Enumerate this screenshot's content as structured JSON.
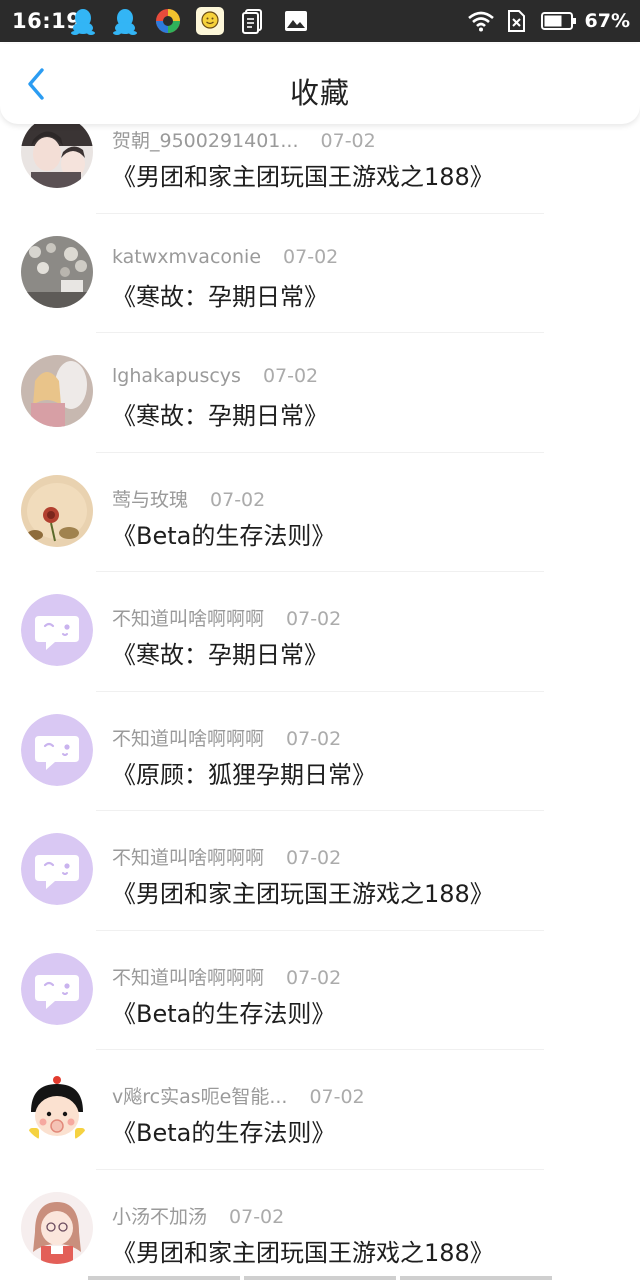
{
  "status_bar": {
    "time": "16:19",
    "battery_percent": "67%",
    "notification_icons": [
      "qq-icon",
      "qq-icon",
      "colorful-app-icon",
      "smiley-app-icon",
      "document-icon",
      "image-icon"
    ]
  },
  "header": {
    "title": "收藏",
    "back_icon": "chevron-left-icon"
  },
  "colors": {
    "accent": "#2b9cf2",
    "status_bar": "#2b2b2b",
    "placeholder_avatar": "#d9c8f3"
  },
  "items": [
    {
      "username": "贺朝_9500291401...",
      "date": "07-02",
      "title": "《男团和家主团玩国王游戏之188》",
      "avatar": "photo-boys"
    },
    {
      "username": "katwxmvaconie",
      "date": "07-02",
      "title": "《寒故：孕期日常》",
      "avatar": "photo-flowers"
    },
    {
      "username": "lghakapuscys",
      "date": "07-02",
      "title": "《寒故：孕期日常》",
      "avatar": "photo-girl-horse"
    },
    {
      "username": "莺与玫瑰",
      "date": "07-02",
      "title": "《Beta的生存法则》",
      "avatar": "photo-rose"
    },
    {
      "username": "不知道叫啥啊啊啊",
      "date": "07-02",
      "title": "《寒故：孕期日常》",
      "avatar": "default-chat-face"
    },
    {
      "username": "不知道叫啥啊啊啊",
      "date": "07-02",
      "title": "《原顾：狐狸孕期日常》",
      "avatar": "default-chat-face"
    },
    {
      "username": "不知道叫啥啊啊啊",
      "date": "07-02",
      "title": "《男团和家主团玩国王游戏之188》",
      "avatar": "default-chat-face"
    },
    {
      "username": "不知道叫啥啊啊啊",
      "date": "07-02",
      "title": "《Beta的生存法则》",
      "avatar": "default-chat-face"
    },
    {
      "username": "v飚rc实as呃e智能...",
      "date": "07-02",
      "title": "《Beta的生存法则》",
      "avatar": "cartoon-baby"
    },
    {
      "username": "小汤不加汤",
      "date": "07-02",
      "title": "《男团和家主团玩国王游戏之188》",
      "avatar": "anime-girl"
    }
  ]
}
